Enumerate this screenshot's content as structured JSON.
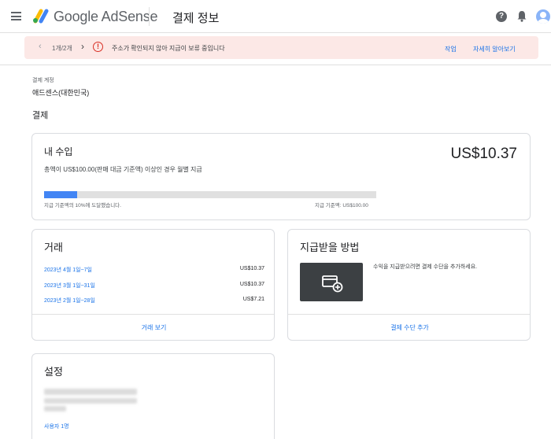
{
  "header": {
    "brand": "Google AdSense",
    "page_title": "결제 정보",
    "help_glyph": "?"
  },
  "alert": {
    "counter": "1개/2개",
    "prev_glyph": "‹",
    "next_glyph": "›",
    "icon_glyph": "!",
    "message": "주소가 확인되지 않아 지급이 보류 중입니다",
    "action": "작업",
    "learn_more": "자세히 알아보기"
  },
  "account": {
    "label": "결제 계정",
    "value": "애드센스(대한민국)"
  },
  "section_title": "결제",
  "earnings": {
    "title": "내 수입",
    "amount": "US$10.37",
    "description": "총액이 US$100.00(판매 대금 기준액) 이상인 경우 월별 지급",
    "progress_fraction": 0.1,
    "progress_text": "지급 기준액의 10%에 도달했습니다.",
    "threshold_text": "지급 기준액: US$100.00"
  },
  "transactions": {
    "title": "거래",
    "rows": [
      {
        "period": "2023년 4월 1일~7일",
        "amount": "US$10.37"
      },
      {
        "period": "2023년 3월 1일~31일",
        "amount": "US$10.37"
      },
      {
        "period": "2023년 2월 1일~28일",
        "amount": "US$7.21"
      }
    ],
    "view_link": "거래 보기"
  },
  "payment": {
    "title": "지급받을 방법",
    "description": "수익을 지급받으려면 결제 수단을 추가하세요.",
    "add_link": "결제 수단 추가"
  },
  "settings": {
    "title": "설정",
    "users_link": "사용자 1명"
  },
  "colors": {
    "accent": "#1a73e8",
    "progress": "#4285f4",
    "alert_bg": "#fce8e6",
    "alert_icon": "#d93025"
  }
}
